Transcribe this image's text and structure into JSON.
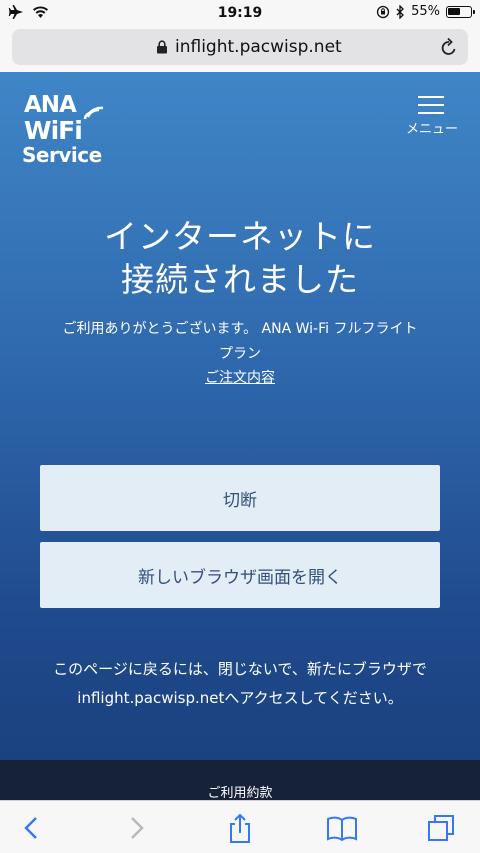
{
  "status_bar": {
    "time": "19:19",
    "battery": "55%",
    "battery_level": 0.55
  },
  "url_bar": {
    "url": "inflight.pacwisp.net"
  },
  "header": {
    "logo_line1": "ANA",
    "logo_line2": "WiFi",
    "logo_line3": "Service",
    "menu_label": "メニュー"
  },
  "main": {
    "title_line1": "インターネットに",
    "title_line2": "接続されました",
    "thanks_line1": "ご利用ありがとうございます。 ANA Wi-Fi フルフライト",
    "thanks_line2": "プラン",
    "order_link": "ご注文内容",
    "disconnect_button": "切断",
    "open_browser_button": "新しいブラウザ画面を開く",
    "notice_line1": "このページに戻るには、閉じないで、新たにブラウザで",
    "notice_line2": "inflight.pacwisp.netへアクセスしてください。"
  },
  "footer": {
    "terms": "ご利用約款"
  },
  "colors": {
    "accent_blue": "#3f86c7",
    "button_bg": "#e2edf6",
    "button_text": "#334f7b",
    "ios_blue": "#3478f6"
  },
  "toolbar": {
    "icons": [
      "back-icon",
      "forward-icon",
      "share-icon",
      "bookmarks-icon",
      "tabs-icon"
    ]
  }
}
